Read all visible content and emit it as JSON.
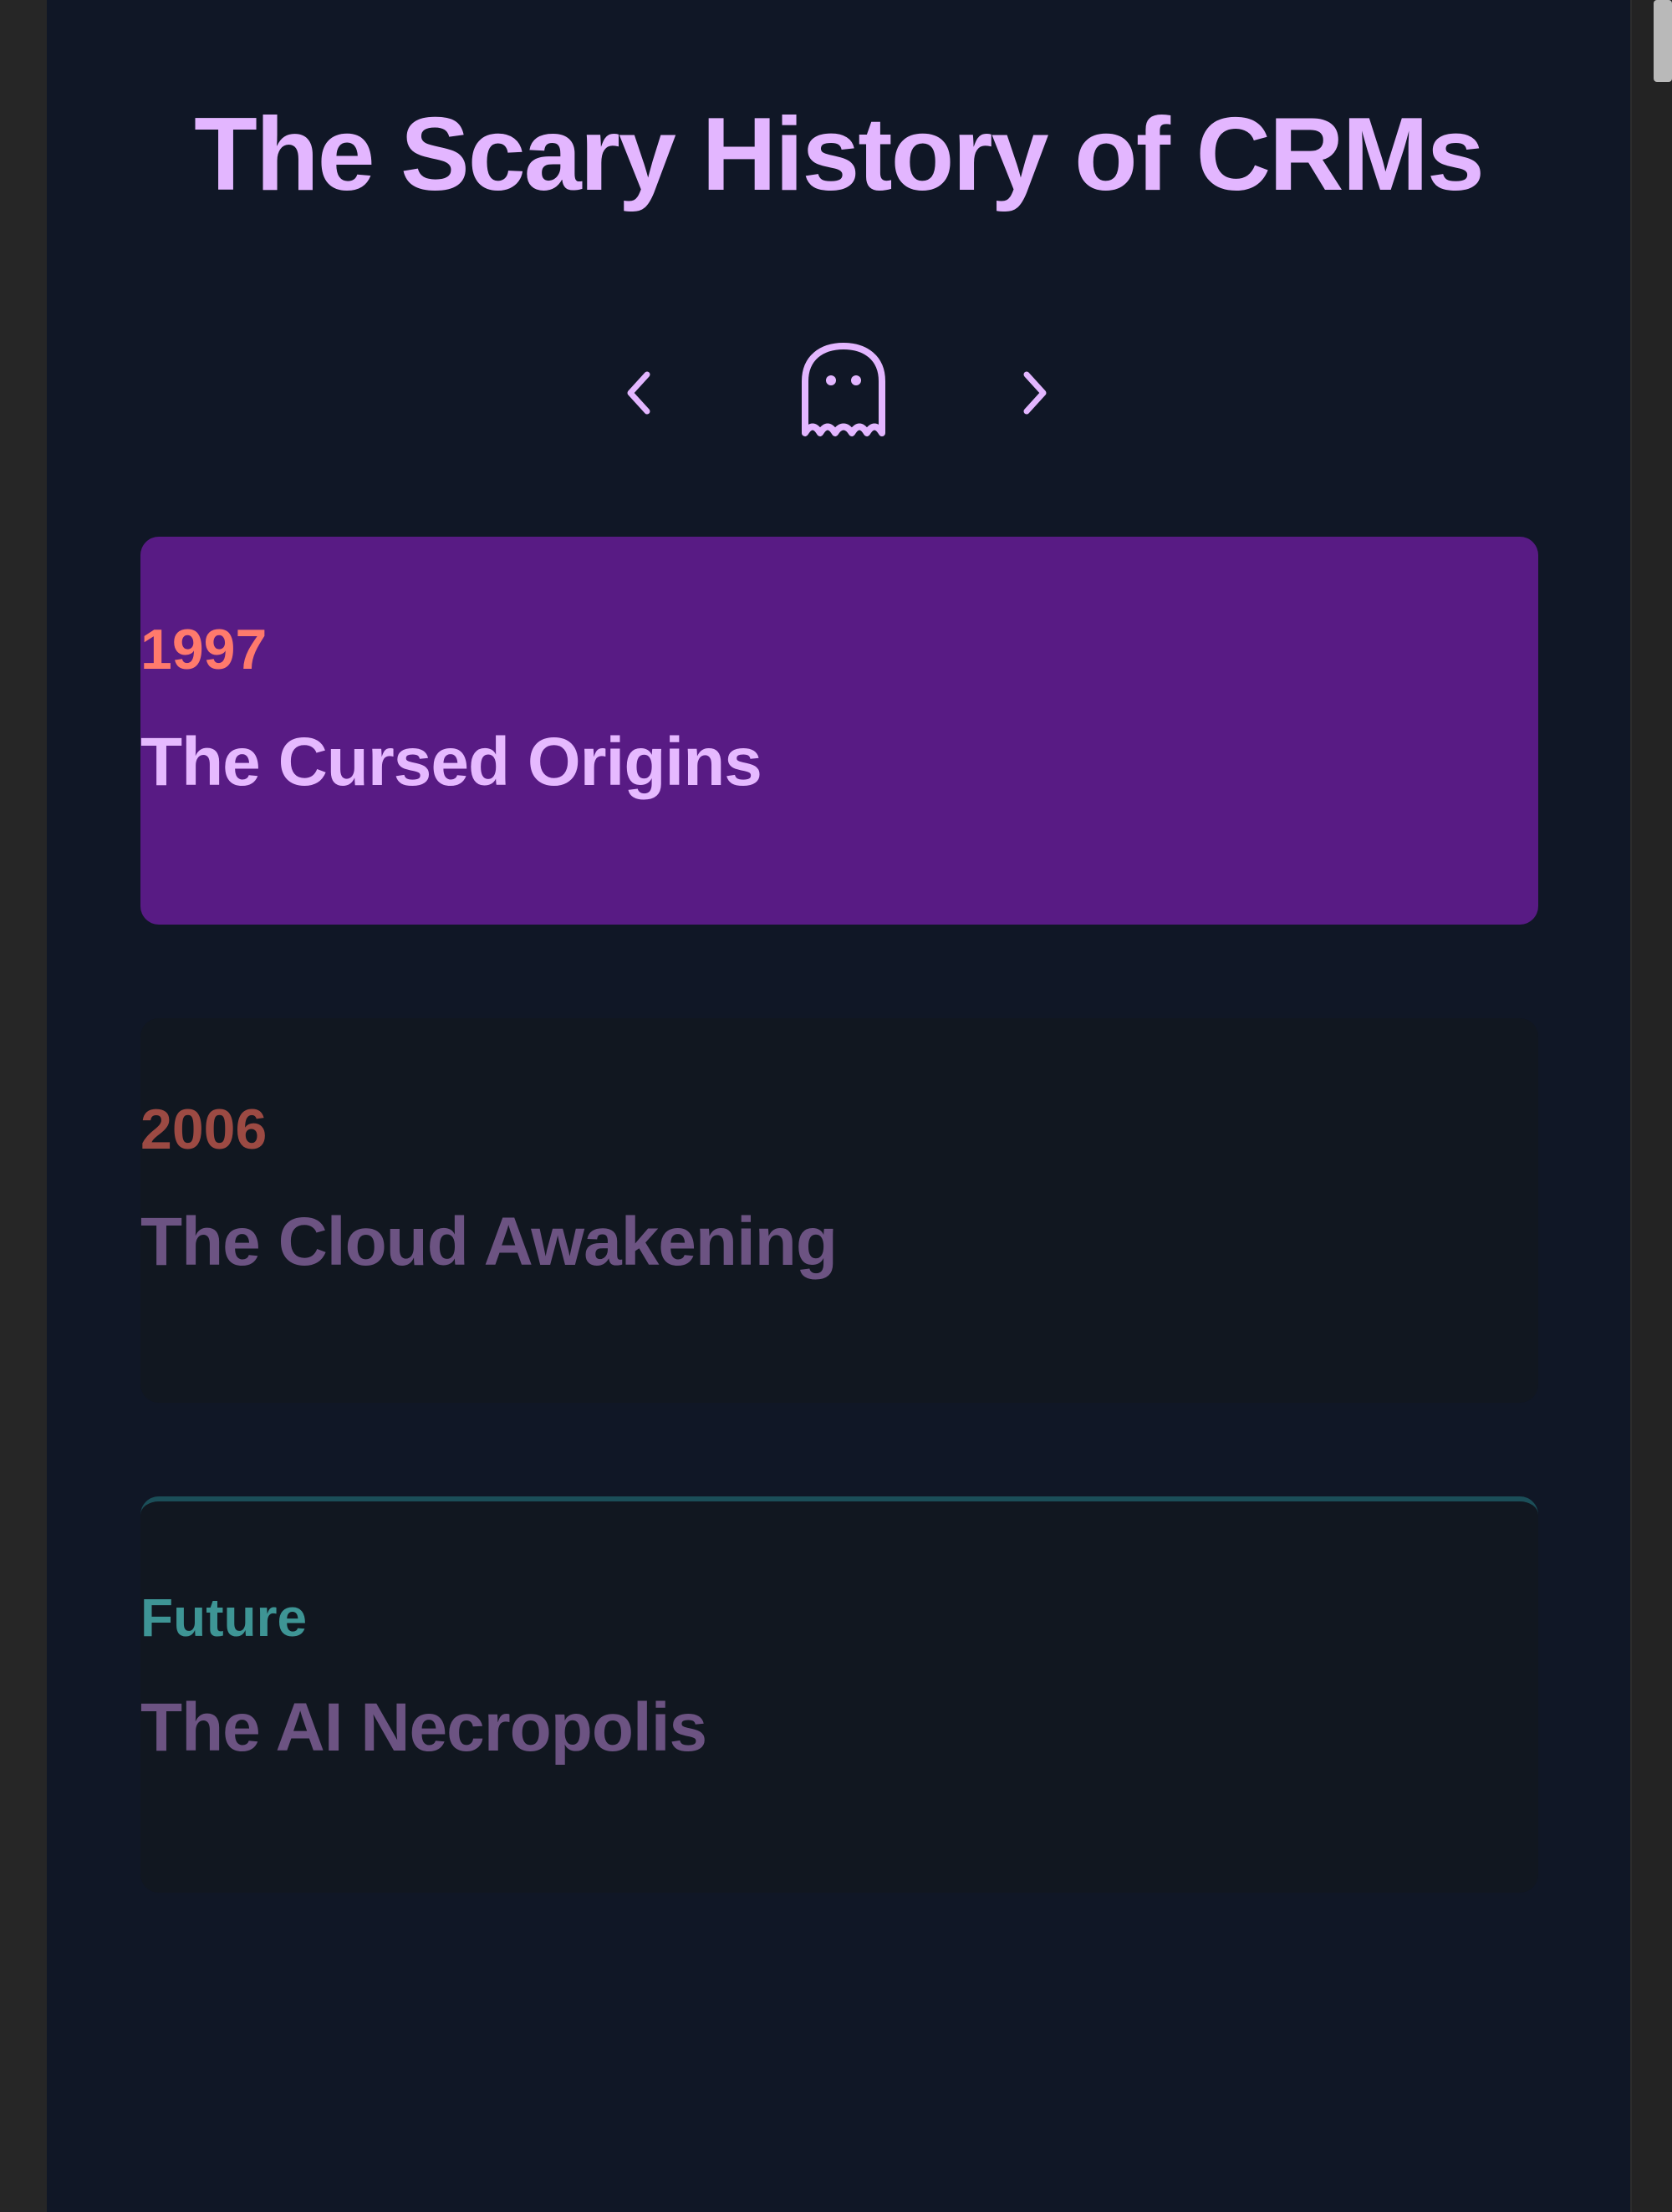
{
  "page": {
    "title": "The Scary History of CRMs"
  },
  "nav": {
    "prev_icon": "chevron-left-icon",
    "center_icon": "ghost-icon",
    "next_icon": "chevron-right-icon"
  },
  "timeline": [
    {
      "year": "1997",
      "title": "The Cursed Origins",
      "state": "active"
    },
    {
      "year": "2006",
      "title": "The Cloud Awakening",
      "state": "inactive"
    },
    {
      "year": "Future",
      "title": "The AI Necropolis",
      "state": "inactive"
    }
  ],
  "colors": {
    "background": "#101726",
    "accent": "#e3b6ff",
    "active_card": "#581b84",
    "inactive_card": "#111720",
    "year_active": "#ff7a6c",
    "year_2006": "#9c4a43",
    "year_future": "#3e9595"
  }
}
